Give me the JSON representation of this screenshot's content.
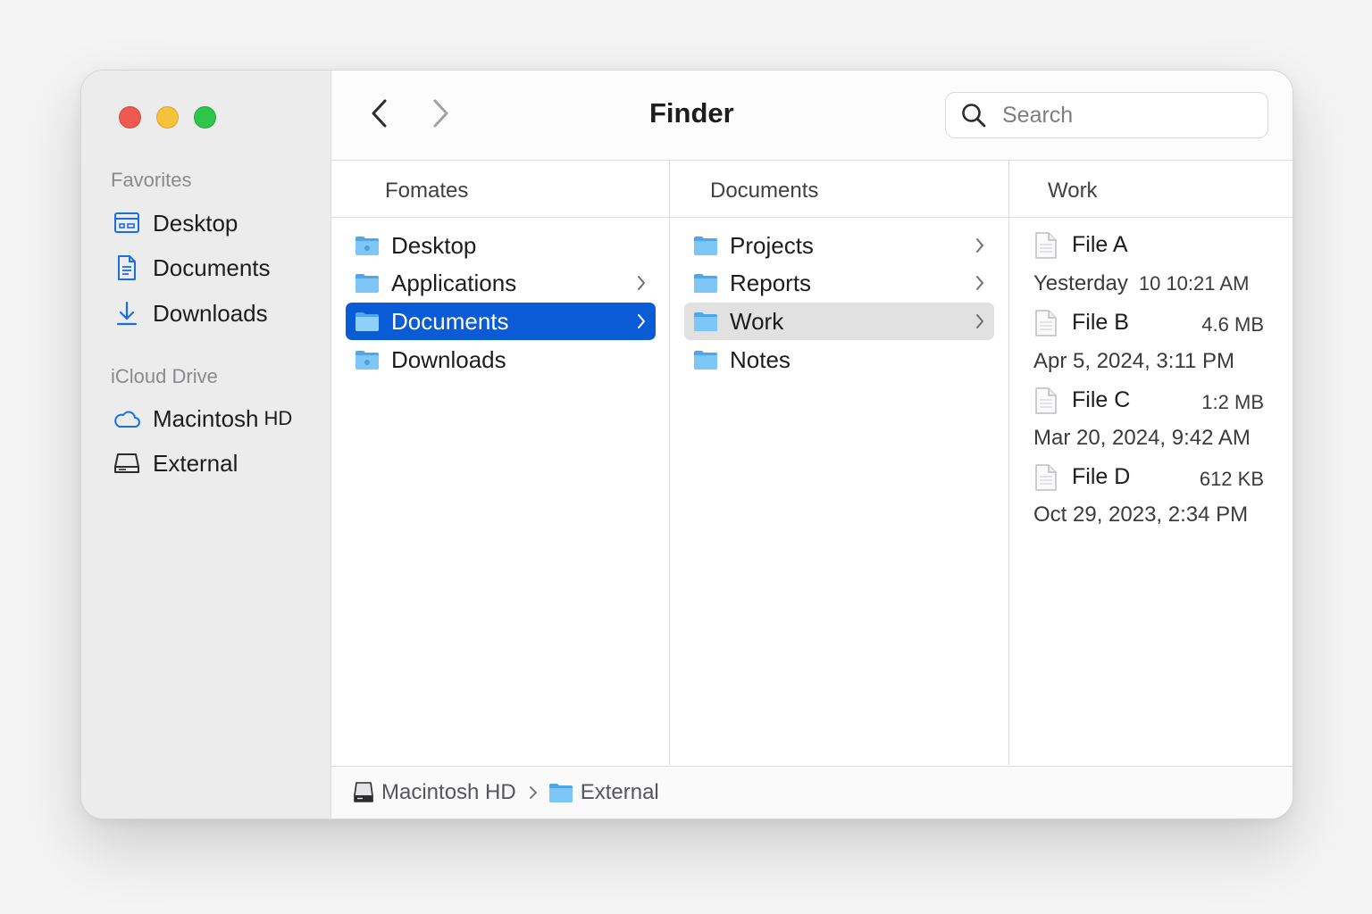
{
  "window": {
    "title": "Finder"
  },
  "sidebar": {
    "sections": [
      {
        "title": "Favorites",
        "items": [
          {
            "label": "Desktop",
            "icon": "desktop-icon"
          },
          {
            "label": "Documents",
            "icon": "document-icon"
          },
          {
            "label": "Downloads",
            "icon": "download-icon"
          }
        ]
      },
      {
        "title": "iCloud Drive",
        "items": [
          {
            "label": "Macintosh",
            "suffix": "HD",
            "icon": "cloud-icon"
          },
          {
            "label": "External",
            "icon": "drive-icon"
          }
        ]
      }
    ]
  },
  "search": {
    "placeholder": "Search"
  },
  "columns": [
    {
      "header": "Fomates",
      "items": [
        {
          "label": "Desktop",
          "has_children": false,
          "state": "normal"
        },
        {
          "label": "Applications",
          "has_children": true,
          "state": "normal"
        },
        {
          "label": "Documents",
          "has_children": true,
          "state": "selected"
        },
        {
          "label": "Downloads",
          "has_children": false,
          "state": "normal"
        }
      ]
    },
    {
      "header": "Documents",
      "items": [
        {
          "label": "Projects",
          "has_children": true,
          "state": "normal"
        },
        {
          "label": "Reports",
          "has_children": true,
          "state": "normal"
        },
        {
          "label": "Work",
          "has_children": true,
          "state": "highlighted"
        },
        {
          "label": "Notes",
          "has_children": false,
          "state": "normal"
        }
      ]
    },
    {
      "header": "Work",
      "files": [
        {
          "name": "File A",
          "size": "",
          "date": "Yesterday",
          "date_extra": "10 10:21 AM"
        },
        {
          "name": "File B",
          "size": "4.6 MB",
          "date": "Apr 5, 2024, 3:11 PM",
          "date_extra": ""
        },
        {
          "name": "File C",
          "size": "1:2 MB",
          "date": "Mar 20, 2024, 9:42 AM",
          "date_extra": ""
        },
        {
          "name": "File D",
          "size": "612 KB",
          "date": "Oct 29, 2023, 2:34 PM",
          "date_extra": ""
        }
      ]
    }
  ],
  "pathbar": {
    "segments": [
      {
        "label": "Macintosh HD",
        "icon": "drive-icon"
      },
      {
        "label": "External",
        "icon": "folder-icon"
      }
    ]
  },
  "colors": {
    "accent": "#0a5bd6",
    "sidebar_icon": "#1a6fe0",
    "folder": "#6cbcf4",
    "close": "#ee5a52",
    "minimize": "#f6c13b",
    "zoom": "#2fc54b"
  }
}
